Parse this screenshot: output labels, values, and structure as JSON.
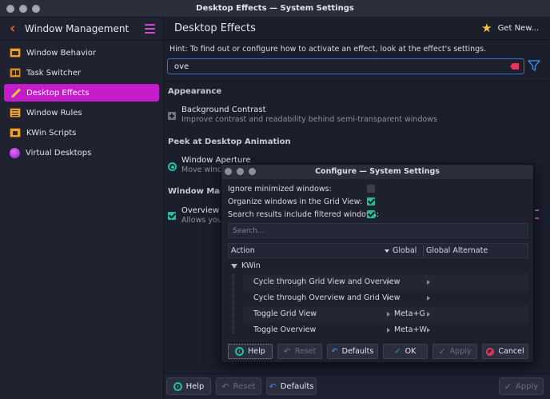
{
  "window": {
    "title": "Desktop Effects — System Settings"
  },
  "sidebar": {
    "back_label": "Window Management",
    "items": [
      {
        "label": "Window Behavior",
        "icon": "window-behavior-icon"
      },
      {
        "label": "Task Switcher",
        "icon": "task-switcher-icon"
      },
      {
        "label": "Desktop Effects",
        "icon": "desktop-effects-icon",
        "active": true
      },
      {
        "label": "Window Rules",
        "icon": "window-rules-icon"
      },
      {
        "label": "KWin Scripts",
        "icon": "kwin-scripts-icon"
      },
      {
        "label": "Virtual Desktops",
        "icon": "virtual-desktops-icon"
      }
    ]
  },
  "main": {
    "title": "Desktop Effects",
    "get_new": "Get New...",
    "hint": "Hint: To find out or configure how to activate an effect, look at the effect's settings.",
    "search_value": "ove",
    "sections": {
      "appearance": "Appearance",
      "peek": "Peek at Desktop Animation",
      "window_management": "Window Manag"
    },
    "effects": {
      "background_contrast": {
        "title": "Background Contrast",
        "desc": "Improve contrast and readability behind semi-transparent windows"
      },
      "window_aperture": {
        "title": "Window Aperture",
        "desc": "Move windo"
      },
      "overview": {
        "title": "Overview",
        "desc": "Allows you"
      }
    },
    "buttons": {
      "help": "Help",
      "reset": "Reset",
      "defaults": "Defaults",
      "apply": "Apply"
    }
  },
  "dialog": {
    "title": "Configure — System Settings",
    "options": [
      {
        "label": "Ignore minimized windows:",
        "checked": false
      },
      {
        "label": "Organize windows in the Grid View:",
        "checked": true
      },
      {
        "label": "Search results include filtered windows:",
        "checked": true
      }
    ],
    "search_placeholder": "Search...",
    "columns": {
      "action": "Action",
      "global": "Global",
      "alternate": "Global Alternate"
    },
    "group": "KWin",
    "rows": [
      {
        "action": "Cycle through Grid View and Overview",
        "global": ""
      },
      {
        "action": "Cycle through Overview and Grid View",
        "global": ""
      },
      {
        "action": "Toggle Grid View",
        "global": "Meta+G"
      },
      {
        "action": "Toggle Overview",
        "global": "Meta+W"
      }
    ],
    "buttons": {
      "help": "Help",
      "reset": "Reset",
      "defaults": "Defaults",
      "ok": "OK",
      "apply": "Apply",
      "cancel": "Cancel"
    }
  },
  "colors": {
    "accent": "#c41ccb",
    "checkbox": "#1fbfa1",
    "focus": "#3a6fd1",
    "warning": "#e8335a"
  }
}
